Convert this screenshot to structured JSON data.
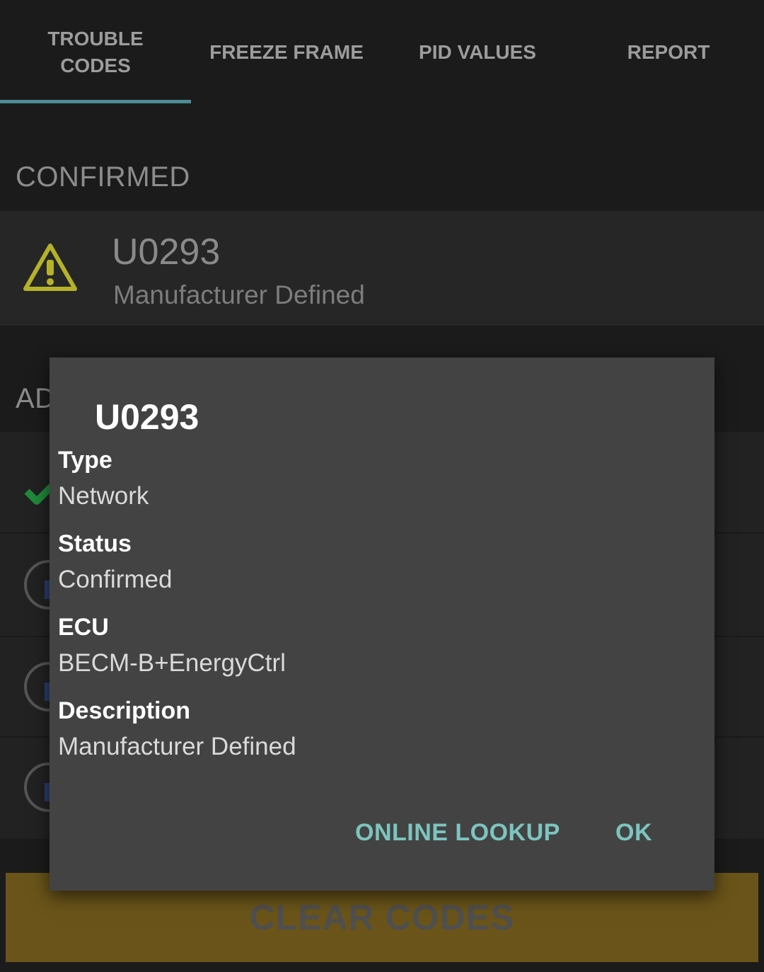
{
  "tabs": [
    {
      "label": "TROUBLE\nCODES",
      "active": true
    },
    {
      "label": "FREEZE FRAME",
      "active": false
    },
    {
      "label": "PID VALUES",
      "active": false
    },
    {
      "label": "REPORT",
      "active": false
    }
  ],
  "sections": {
    "confirmed": "CONFIRMED",
    "additional_partial": "AD"
  },
  "confirmed_code": {
    "code": "U0293",
    "description": "Manufacturer Defined",
    "icon": "warning-triangle-icon"
  },
  "background_list_icons": [
    "check-icon",
    "info-icon",
    "info-icon",
    "info-icon"
  ],
  "dialog": {
    "title": "U0293",
    "fields": [
      {
        "label": "Type",
        "value": "Network"
      },
      {
        "label": "Status",
        "value": "Confirmed"
      },
      {
        "label": "ECU",
        "value": "BECM-B+EnergyCtrl"
      },
      {
        "label": "Description",
        "value": "Manufacturer Defined"
      }
    ],
    "buttons": {
      "online_lookup": "ONLINE LOOKUP",
      "ok": "OK"
    }
  },
  "clear_button": "CLEAR CODES",
  "colors": {
    "accent": "#4d8c93",
    "dialog_button": "#7dc4bf",
    "warning": "#b5b22a",
    "check": "#1f8a3a",
    "clear_button_bg": "#6a5419"
  }
}
